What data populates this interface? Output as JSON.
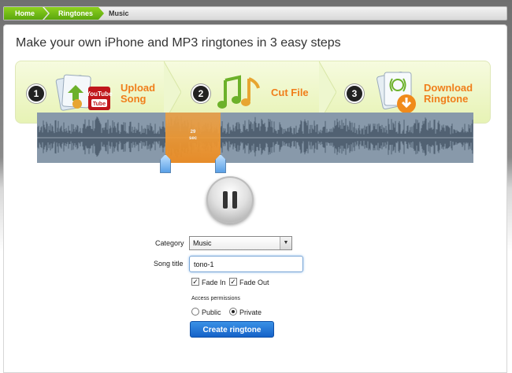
{
  "breadcrumb": {
    "home": "Home",
    "ringtones": "Ringtones",
    "current": "Music"
  },
  "headline": "Make your own iPhone and MP3 ringtones in 3 easy steps",
  "steps": [
    {
      "number": "1",
      "line1": "Upload",
      "line2": "Song",
      "icon": "upload-song-youtube-icon",
      "badge": "YouTube"
    },
    {
      "number": "2",
      "line1": "Cut File",
      "line2": "",
      "icon": "music-notes-icon"
    },
    {
      "number": "3",
      "line1": "Download",
      "line2": "Ringtone",
      "icon": "download-ringtone-icon"
    }
  ],
  "waveform": {
    "selection_seconds": "29",
    "selection_unit": "sec"
  },
  "player": {
    "state_icon": "pause-icon"
  },
  "form": {
    "category_label": "Category",
    "category_value": "Music",
    "song_title_label": "Song title",
    "song_title_value": "tono-1",
    "fade_in_label": "Fade In",
    "fade_in_checked": true,
    "fade_out_label": "Fade Out",
    "fade_out_checked": true,
    "access_label": "Access permissions",
    "public_label": "Public",
    "private_label": "Private",
    "access_selected": "Private",
    "create_button": "Create ringtone"
  },
  "colors": {
    "accent_green": "#5aa60e",
    "step_orange": "#f07e1b",
    "selection_orange": "#f19a33",
    "button_blue": "#1562c8"
  }
}
